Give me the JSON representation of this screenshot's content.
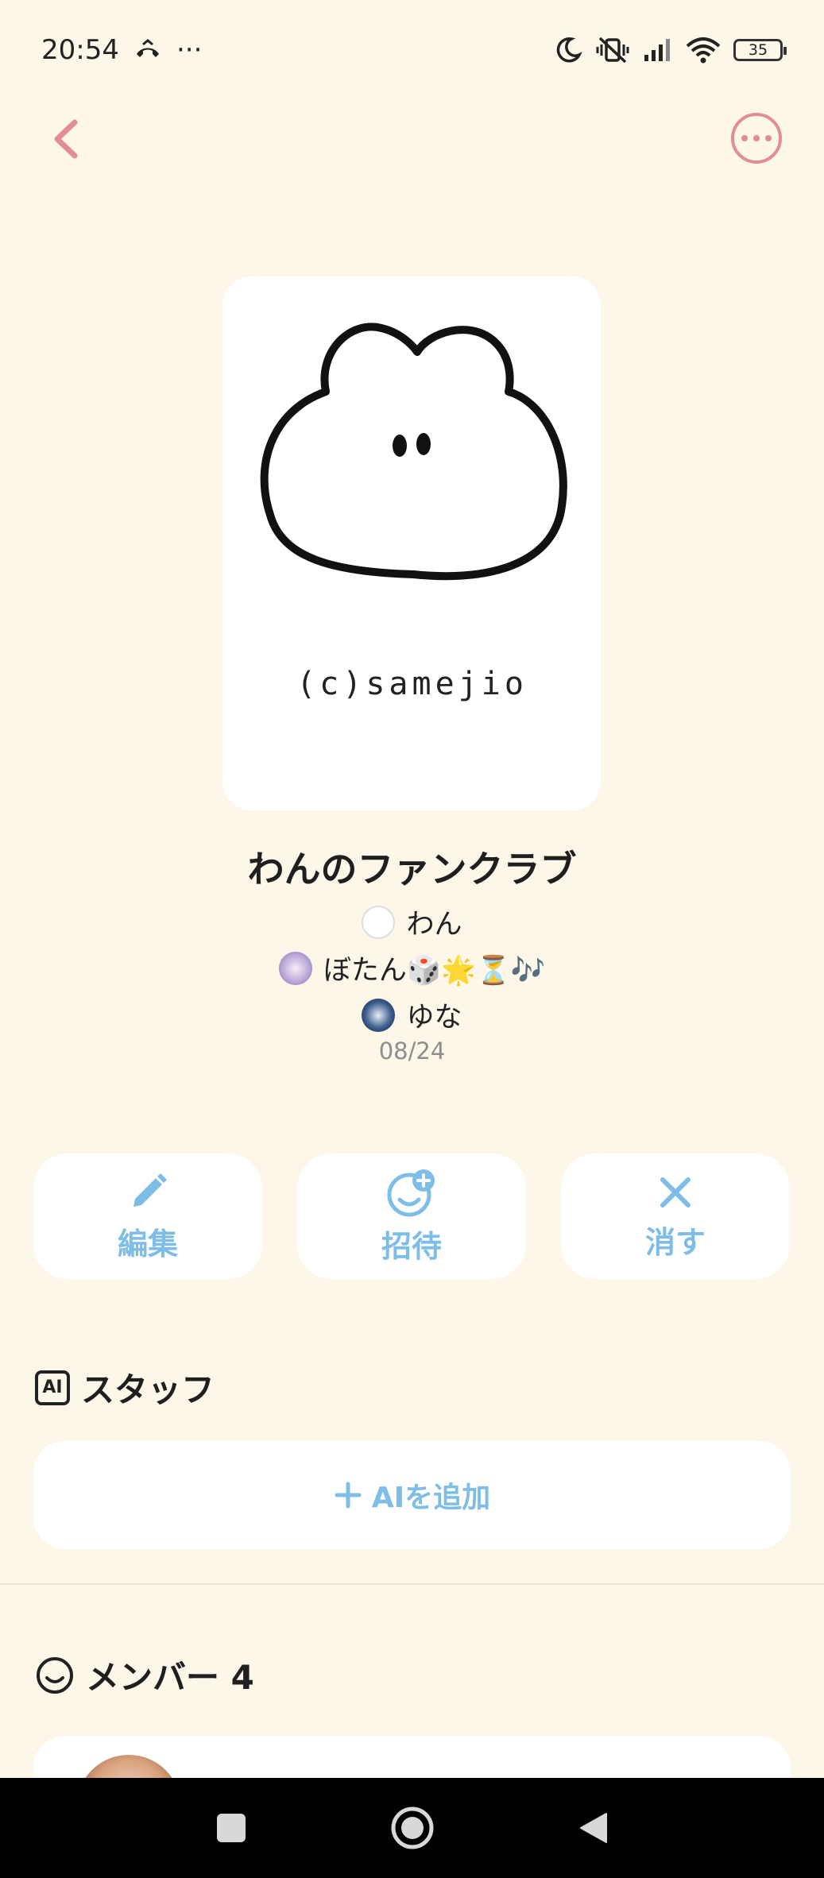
{
  "status_bar": {
    "time": "20:54",
    "dots": "···",
    "battery": "35"
  },
  "club": {
    "image_credit": "(c)samejio",
    "title": "わんのファンクラブ",
    "members": [
      {
        "name": "わん"
      },
      {
        "name": "ぼたん🎲🌟⏳🎶"
      },
      {
        "name": "ゆな"
      }
    ],
    "date": "08/24"
  },
  "actions": {
    "edit_label": "編集",
    "invite_label": "招待",
    "delete_label": "消す"
  },
  "staff_section": {
    "badge": "AI",
    "title": "スタッフ",
    "add_ai_label": "AIを追加"
  },
  "members_section": {
    "title": "メンバー 4"
  },
  "colors": {
    "background": "#fdf7ea",
    "accent_pink": "#e18c96",
    "accent_blue": "#7dbde6"
  },
  "icons": {
    "back": "chevron-left-icon",
    "more": "more-options-icon",
    "edit": "pencil-icon",
    "invite": "add-person-icon",
    "delete": "close-icon",
    "staff": "ai-badge-icon",
    "members": "smiley-icon"
  }
}
